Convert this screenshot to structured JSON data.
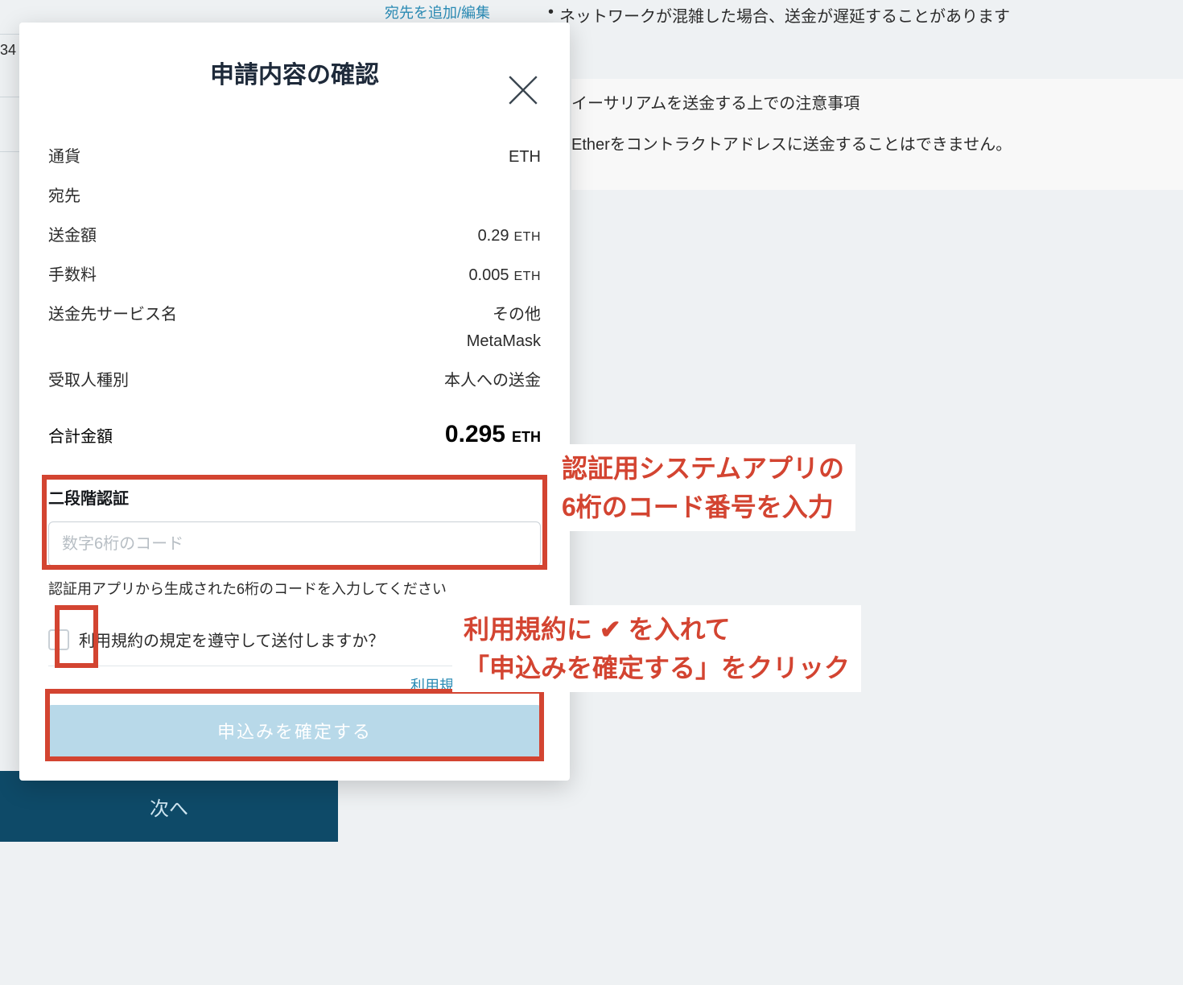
{
  "background": {
    "edit_link": "宛先を追加/編集",
    "network_warning": "ネットワークが混雑した場合、送金が遅延することがあります",
    "eth_note_heading": "イーサリアムを送金する上での注意事項",
    "eth_note_body": "Etherをコントラクトアドレスに送金することはできません。",
    "left_fragment": "34",
    "next_button": "次へ"
  },
  "modal": {
    "title": "申請内容の確認",
    "rows": {
      "currency_label": "通貨",
      "currency_value": "ETH",
      "address_label": "宛先",
      "address_value": "",
      "amount_label": "送金額",
      "amount_value": "0.29",
      "amount_unit": "ETH",
      "fee_label": "手数料",
      "fee_value": "0.005",
      "fee_unit": "ETH",
      "service_label": "送金先サービス名",
      "service_value": "その他",
      "service_extra": "MetaMask",
      "recipient_label": "受取人種別",
      "recipient_value": "本人への送金"
    },
    "total": {
      "label": "合計金額",
      "value": "0.295",
      "unit": "ETH"
    },
    "tfa": {
      "heading": "二段階認証",
      "placeholder": "数字6桁のコード",
      "help": "認証用アプリから生成された6桁のコードを入力してください"
    },
    "tos": {
      "label": "利用規約の規定を遵守して送付しますか？",
      "link": "利用規約を確認する"
    },
    "confirm_button": "申込みを確定する"
  },
  "annotations": {
    "tfa_line1": "認証用システムアプリの",
    "tfa_line2": "6桁のコード番号を入力",
    "tos_line1": "利用規約に ✔ を入れて",
    "tos_line2": "「申込みを確定する」をクリック"
  }
}
